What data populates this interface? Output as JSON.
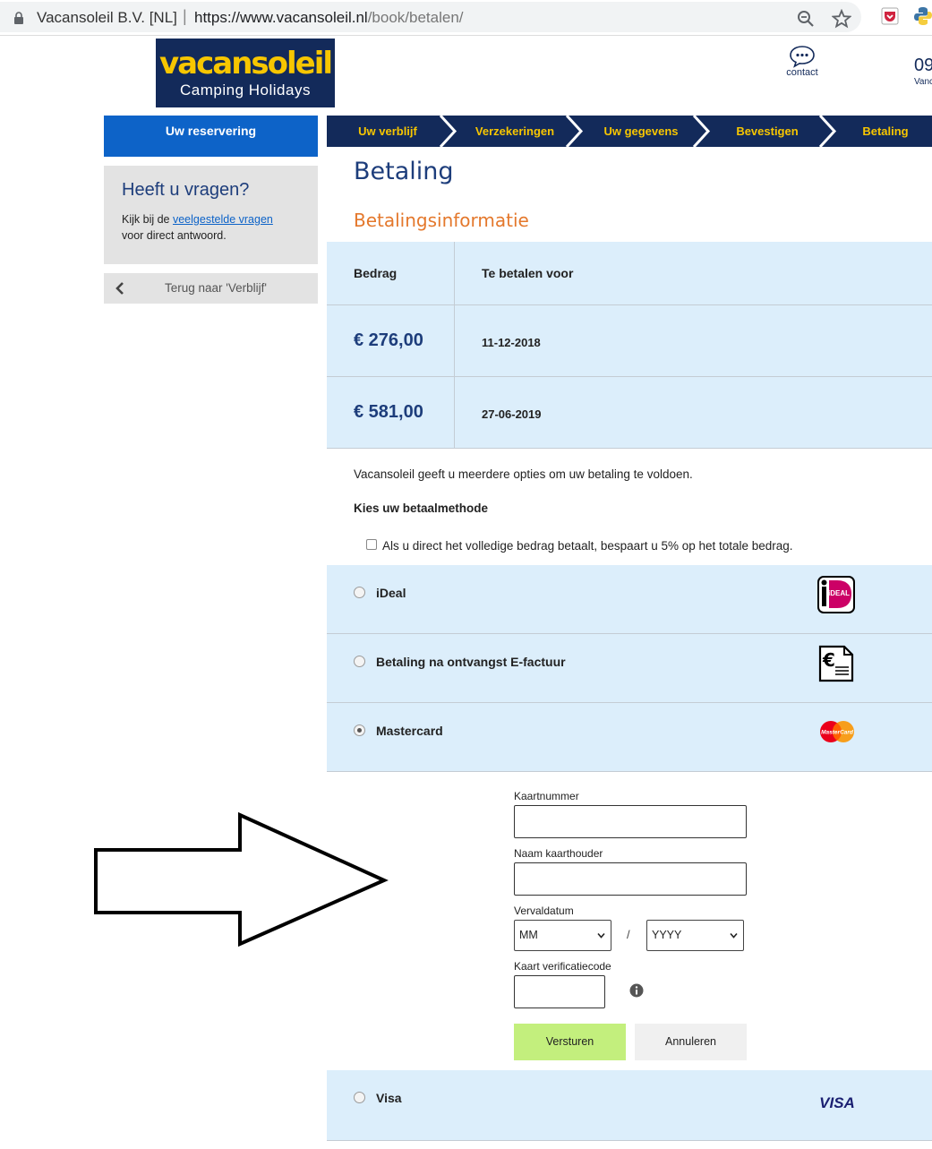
{
  "browser": {
    "site_name": "Vacansoleil B.V. [NL]",
    "separator": "|",
    "url_host": "https://www.vacansoleil.nl",
    "url_path": "/book/betalen/"
  },
  "header": {
    "logo_top": "vacansoleil",
    "logo_bottom": "Camping Holidays",
    "contact_label": "contact",
    "phone_partial": "09",
    "phone_sub_partial": "Vanc"
  },
  "sidebar": {
    "reservation_tab": "Uw reservering",
    "help_title": "Heeft u vragen?",
    "help_text_before": "Kijk bij de ",
    "help_link": "veelgestelde vragen",
    "help_text_after": "voor direct antwoord.",
    "back_button": "Terug naar 'Verblijf'"
  },
  "steps": [
    "Uw verblijf",
    "Verzekeringen",
    "Uw gegevens",
    "Bevestigen",
    "Betaling"
  ],
  "main": {
    "page_title": "Betaling",
    "section_title": "Betalingsinformatie",
    "table": {
      "headers": [
        "Bedrag",
        "Te betalen voor"
      ],
      "rows": [
        {
          "amount": "€ 276,00",
          "date": "11-12-2018"
        },
        {
          "amount": "€ 581,00",
          "date": "27-06-2019"
        }
      ]
    },
    "info_text": "Vacansoleil geeft u meerdere opties om uw betaling te voldoen.",
    "choose_label": "Kies uw betaalmethode",
    "discount_text": "Als u direct het volledige bedrag betaalt, bespaart u 5% op het totale bedrag.",
    "methods": [
      {
        "label": "iDeal",
        "icon": "ideal-logo",
        "selected": false
      },
      {
        "label": "Betaling na ontvangst E-factuur",
        "icon": "euro-invoice-icon",
        "selected": false
      },
      {
        "label": "Mastercard",
        "icon": "mastercard-logo",
        "selected": true
      },
      {
        "label": "Visa",
        "icon": "visa-logo",
        "selected": false
      }
    ],
    "ideal_logo_text": "iDEAL",
    "mastercard_logo_text": "MasterCard",
    "visa_logo_text": "VISA",
    "card_form": {
      "card_number_label": "Kaartnummer",
      "card_number_value": "",
      "holder_label": "Naam kaarthouder",
      "holder_value": "",
      "expiry_label": "Vervaldatum",
      "month_value": "MM",
      "year_value": "YYYY",
      "expiry_separator": "/",
      "cvc_label": "Kaart verificatiecode",
      "cvc_value": "",
      "submit_label": "Versturen",
      "cancel_label": "Annuleren"
    }
  },
  "colors": {
    "navy": "#132a5a",
    "brand_yellow": "#f7c600",
    "accent_blue": "#0d63c8",
    "orange_heading": "#e4782c",
    "light_blue_panel": "#dceefb",
    "submit_green": "#c3ef7d"
  }
}
